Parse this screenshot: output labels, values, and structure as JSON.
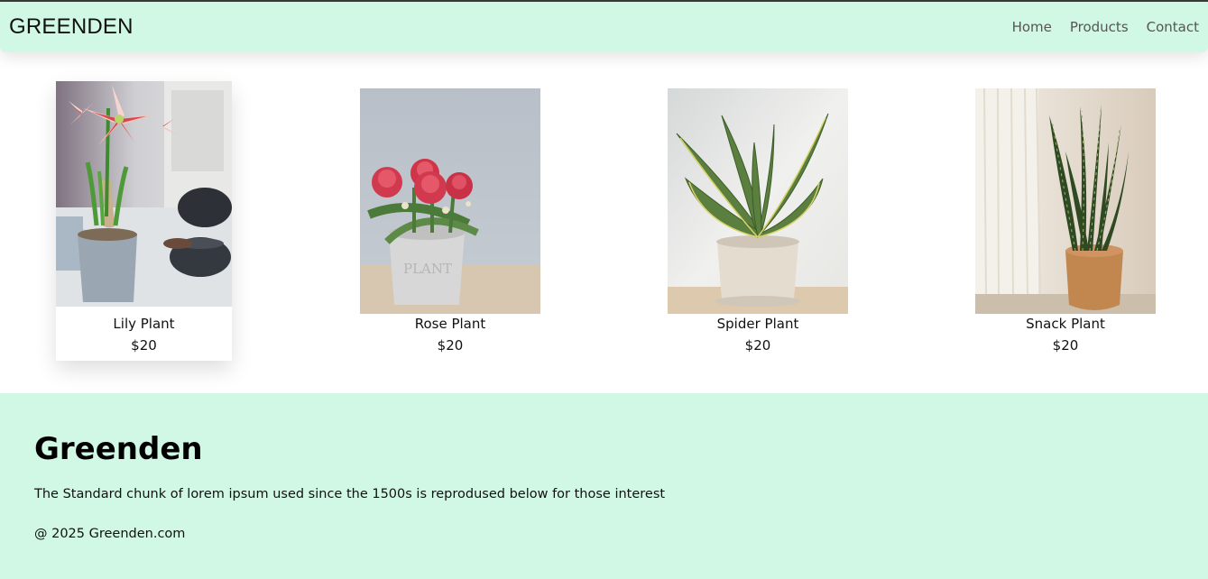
{
  "navbar": {
    "brand": "GREENDEN",
    "links": [
      "Home",
      "Products",
      "Contact"
    ]
  },
  "products": [
    {
      "name": "Lily Plant",
      "price": "$20",
      "image": "lily-plant-photo"
    },
    {
      "name": "Rose Plant",
      "price": "$20",
      "image": "rose-plant-photo"
    },
    {
      "name": "Spider Plant",
      "price": "$20",
      "image": "spider-plant-photo"
    },
    {
      "name": "Snack Plant",
      "price": "$20",
      "image": "snake-plant-photo"
    }
  ],
  "footer": {
    "title": "Greenden",
    "description": "The Standard chunk of lorem ipsum used since the 1500s is reprodused below for those interest",
    "copyright": "@ 2025 Greenden.com"
  },
  "colors": {
    "header_bg": "#d1f8e4",
    "footer_bg": "#d1f8e4",
    "page_bg": "#ffffff"
  }
}
